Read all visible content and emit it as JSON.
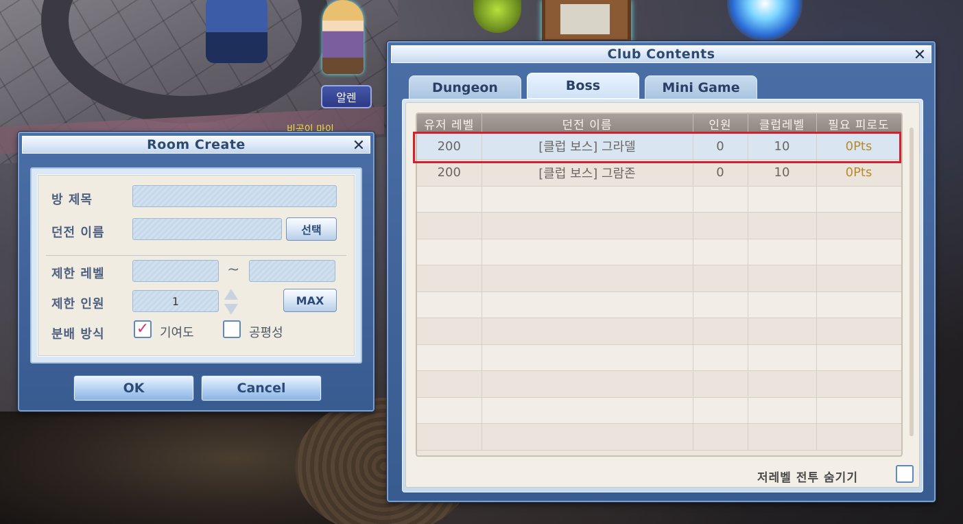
{
  "scene": {
    "npc_name_tag": "알렌",
    "npc_subtitle": "비공이 마이"
  },
  "room_create": {
    "title": "Room Create",
    "labels": {
      "room_title": "방 제목",
      "dungeon_name": "던전 이름",
      "level_limit": "제한 레벨",
      "member_limit": "제한 인원",
      "distribution": "분배 방식"
    },
    "fields": {
      "room_title_value": "",
      "dungeon_name_value": "",
      "level_min_value": "",
      "level_max_value": "",
      "member_value": "1"
    },
    "tilde": "~",
    "select_button": "선택",
    "max_button": "MAX",
    "distribution_options": [
      {
        "label": "기여도",
        "checked": true
      },
      {
        "label": "공평성",
        "checked": false
      }
    ],
    "ok_button": "OK",
    "cancel_button": "Cancel"
  },
  "club_contents": {
    "title": "Club Contents",
    "tabs": [
      {
        "label": "Dungeon",
        "active": false
      },
      {
        "label": "Boss",
        "active": true
      },
      {
        "label": "Mini Game",
        "active": false
      }
    ],
    "columns": [
      "유저 레벨",
      "던전 이름",
      "인원",
      "클럽레벨",
      "필요 피로도"
    ],
    "rows": [
      {
        "user_level": "200",
        "dungeon": "[클럽 보스] 그라델",
        "members": "0",
        "club_level": "10",
        "fatigue": "0Pts",
        "selected": true
      },
      {
        "user_level": "200",
        "dungeon": "[클럽 보스] 그람존",
        "members": "0",
        "club_level": "10",
        "fatigue": "0Pts",
        "selected": false
      }
    ],
    "empty_row_count": 10,
    "hide_low_level_label": "저레벨 전투 숨기기",
    "hide_low_level_checked": false
  }
}
